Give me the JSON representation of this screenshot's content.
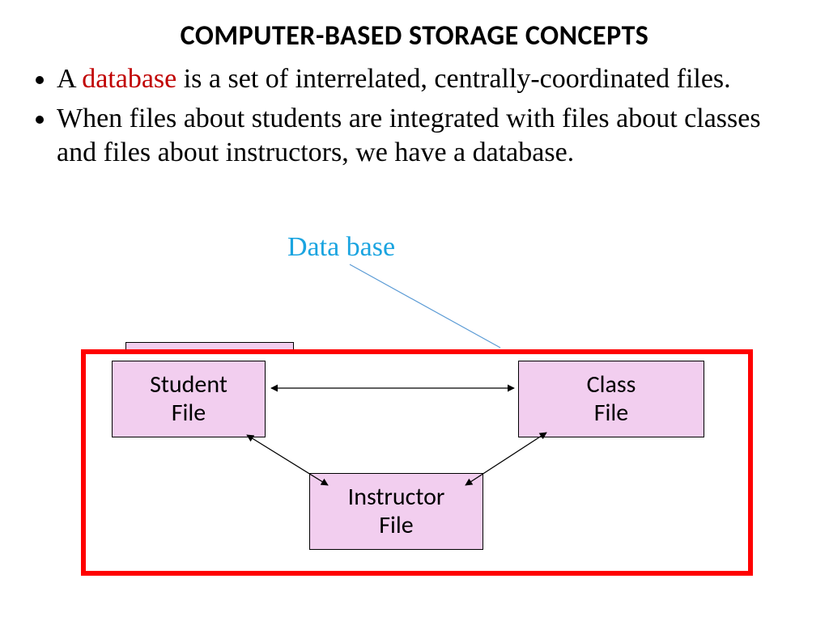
{
  "title": "COMPUTER-BASED STORAGE CONCEPTS",
  "bullets": {
    "b1_pre": "A ",
    "b1_em": "database",
    "b1_post": " is a set of interrelated, centrally-coordinated files.",
    "b2": "When files about students are integrated with files about classes and files about instructors, we have a database."
  },
  "labels": {
    "database": "Data base"
  },
  "boxes": {
    "student": "Student\nFile",
    "class": "Class\nFile",
    "instructor": "Instructor\nFile"
  }
}
